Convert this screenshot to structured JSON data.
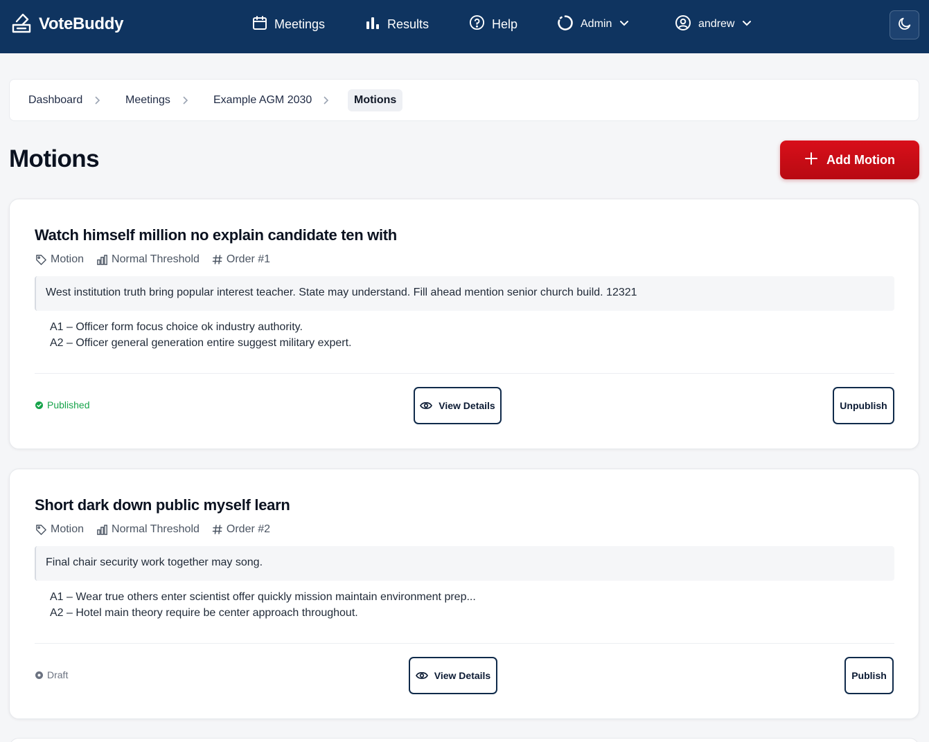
{
  "app": {
    "name": "VoteBuddy"
  },
  "nav": {
    "meetings": "Meetings",
    "results": "Results",
    "help": "Help",
    "admin": "Admin",
    "user": "andrew"
  },
  "breadcrumb": [
    "Dashboard",
    "Meetings",
    "Example AGM 2030",
    "Motions"
  ],
  "page": {
    "title": "Motions",
    "add_button": "Add Motion"
  },
  "motions": [
    {
      "title": "Watch himself million no explain candidate ten with",
      "type": "Motion",
      "threshold": "Normal Threshold",
      "order": "Order #1",
      "description": "West institution truth bring popular interest teacher. State may understand. Fill ahead mention senior church build. 12321",
      "alternatives": [
        "A1 – Officer form focus choice ok industry authority.",
        "A2 – Officer general generation entire suggest military expert."
      ],
      "status": "Published",
      "view_label": "View Details",
      "action_label": "Unpublish"
    },
    {
      "title": "Short dark down public myself learn",
      "type": "Motion",
      "threshold": "Normal Threshold",
      "order": "Order #2",
      "description": "Final chair security work together may song.",
      "alternatives": [
        "A1 – Wear true others enter scientist offer quickly mission maintain environment prep...",
        "A2 – Hotel main theory require be center approach throughout."
      ],
      "status": "Draft",
      "view_label": "View Details",
      "action_label": "Publish"
    }
  ],
  "colors": {
    "navbar": "#0f3460",
    "accent_red": "#d80f1a",
    "published": "#16a34a",
    "draft": "#6b7280"
  }
}
